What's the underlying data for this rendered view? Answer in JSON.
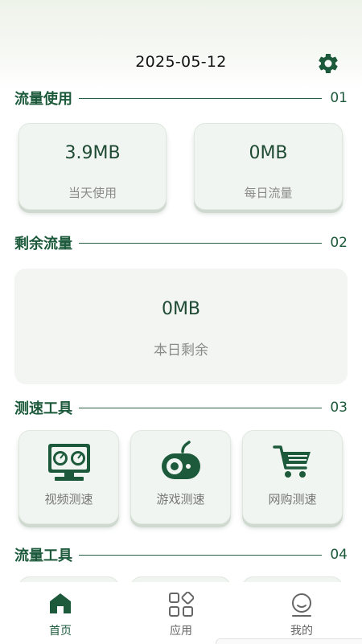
{
  "header": {
    "date": "2025-05-12",
    "settings_icon": "gear-icon"
  },
  "sections": {
    "usage": {
      "title": "流量使用",
      "number": "01"
    },
    "remaining": {
      "title": "剩余流量",
      "number": "02"
    },
    "speed_tools": {
      "title": "测速工具",
      "number": "03"
    },
    "data_tools": {
      "title": "流量工具",
      "number": "04"
    }
  },
  "usage": {
    "today": {
      "value": "3.9MB",
      "label": "当天使用"
    },
    "daily": {
      "value": "0MB",
      "label": "每日流量"
    }
  },
  "remaining": {
    "value": "0MB",
    "label": "本日剩余"
  },
  "tools": [
    {
      "label": "视频测速",
      "icon": "monitor-speed-icon"
    },
    {
      "label": "游戏测速",
      "icon": "gamepad-icon"
    },
    {
      "label": "网购测速",
      "icon": "shopping-cart-icon"
    }
  ],
  "tabbar": {
    "items": [
      {
        "label": "首页",
        "icon": "home-icon",
        "active": true
      },
      {
        "label": "应用",
        "icon": "apps-grid-icon",
        "active": false
      },
      {
        "label": "我的",
        "icon": "profile-icon",
        "active": false
      }
    ],
    "active_color": "#1d5a3b",
    "inactive_color": "#666666"
  },
  "colors": {
    "accent": "#1d5a3b",
    "card_bg": "#f1f5f1"
  }
}
